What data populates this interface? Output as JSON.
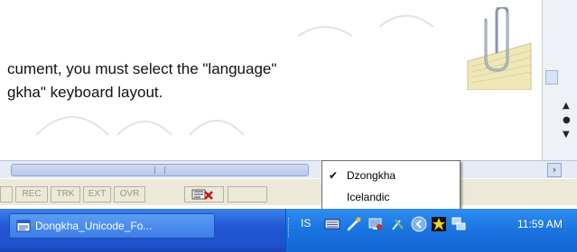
{
  "document": {
    "line1": "cument, you must select the \"language\"",
    "line2": "gkha\" keyboard layout."
  },
  "status_bar": {
    "rec": "REC",
    "trk": "TRK",
    "ext": "EXT",
    "ovr": "OVR"
  },
  "language_menu": {
    "items": [
      {
        "label": "Dzongkha",
        "checked": true
      },
      {
        "label": "Icelandic",
        "checked": false
      }
    ]
  },
  "taskbar": {
    "task_button_label": "Dongkha_Unicode_Fo...",
    "language_indicator": "IS",
    "clock": "11:59 AM"
  },
  "icons": {
    "office_assistant": "paperclip-assistant-icon",
    "spelling_status": "spelling-error-icon",
    "task": "word-document-icon",
    "tray": [
      "keyboard-icon",
      "pen-icon",
      "monitor-icon",
      "tools-icon",
      "chevron-left-icon",
      "star-icon",
      "network-icon"
    ]
  }
}
